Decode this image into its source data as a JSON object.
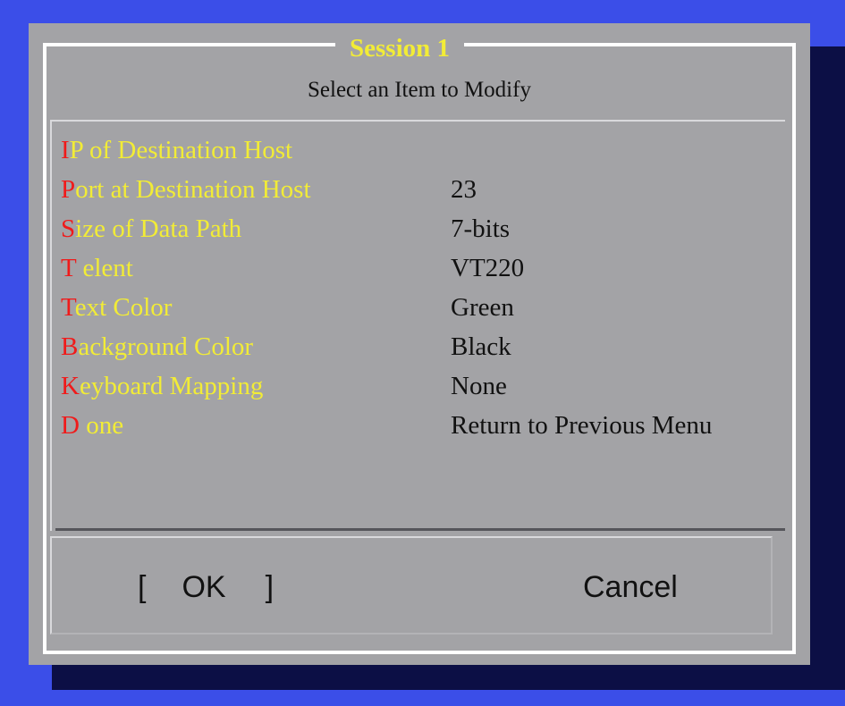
{
  "dialog": {
    "title": "Session 1",
    "subtitle": "Select an Item to Modify",
    "items": [
      {
        "hotkey": "I",
        "label": "P of Destination Host",
        "value": ""
      },
      {
        "hotkey": "P",
        "label": "ort at Destination Host",
        "value": "23"
      },
      {
        "hotkey": "S",
        "label": "ize of Data Path",
        "value": "7-bits"
      },
      {
        "hotkey": "T",
        "label": " elent",
        "value": "VT220"
      },
      {
        "hotkey": "T",
        "label": "ext Color",
        "value": "Green"
      },
      {
        "hotkey": "B",
        "label": "ackground Color",
        "value": "Black"
      },
      {
        "hotkey": "K",
        "label": "eyboard Mapping",
        "value": "None"
      },
      {
        "hotkey": "D",
        "label": " one",
        "value": "Return to Previous Menu"
      }
    ],
    "buttons": {
      "ok_open": "[",
      "ok_label": "OK",
      "ok_close": "]",
      "cancel_label": "Cancel"
    }
  },
  "colors": {
    "background": "#3b4ee8",
    "shadow": "#0c0f45",
    "panel": "#a3a3a6",
    "hotkey": "#f01a1a",
    "label": "#f2ec36",
    "value": "#111111"
  }
}
